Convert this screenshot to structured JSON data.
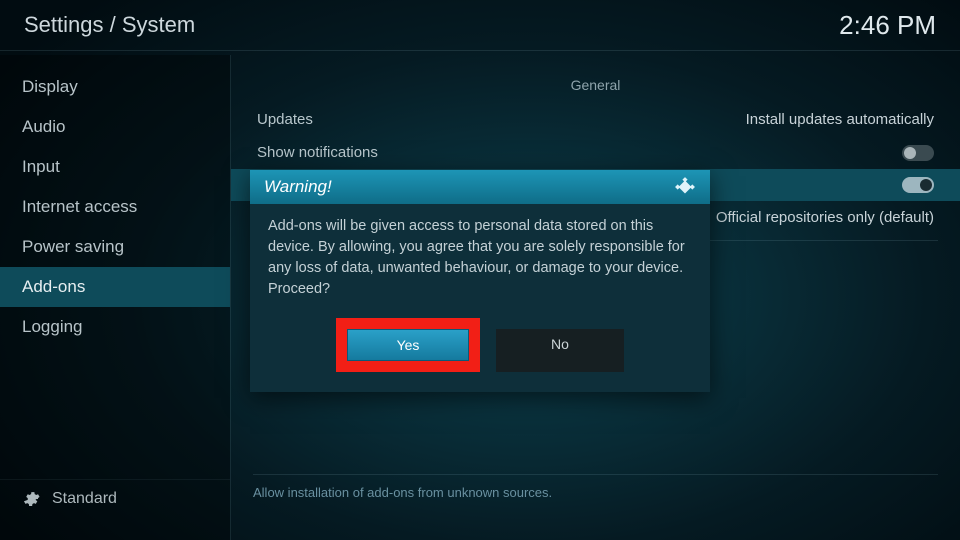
{
  "header": {
    "breadcrumb": "Settings / System",
    "clock": "2:46 PM"
  },
  "sidebar": {
    "items": [
      {
        "label": "Display",
        "active": false
      },
      {
        "label": "Audio",
        "active": false
      },
      {
        "label": "Input",
        "active": false
      },
      {
        "label": "Internet access",
        "active": false
      },
      {
        "label": "Power saving",
        "active": false
      },
      {
        "label": "Add-ons",
        "active": true
      },
      {
        "label": "Logging",
        "active": false
      }
    ],
    "footer_label": "Standard"
  },
  "main": {
    "section_title": "General",
    "rows": {
      "updates": {
        "label": "Updates",
        "value": "Install updates automatically"
      },
      "notifications": {
        "label": "Show notifications",
        "toggle": false
      },
      "unknown_sources_toggle": {
        "toggle": true
      },
      "sources": {
        "value": "Official repositories only (default)"
      }
    },
    "footnote": "Allow installation of add-ons from unknown sources."
  },
  "dialog": {
    "title": "Warning!",
    "body": "Add-ons will be given access to personal data stored on this device. By allowing, you agree that you are solely responsible for any loss of data, unwanted behaviour, or damage to your device. Proceed?",
    "yes_label": "Yes",
    "no_label": "No"
  }
}
